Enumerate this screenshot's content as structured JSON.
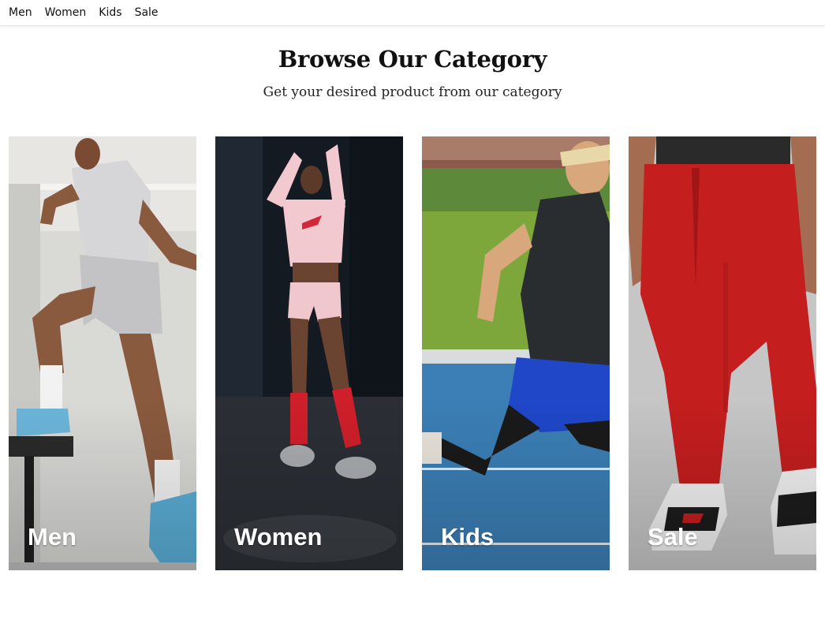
{
  "nav": {
    "items": [
      "Men",
      "Women",
      "Kids",
      "Sale"
    ]
  },
  "hero": {
    "title": "Browse Our Category",
    "subtitle": "Get your desired product from our category"
  },
  "categories": [
    {
      "label": "Men",
      "image": "man-stepping-on-bench-photo"
    },
    {
      "label": "Women",
      "image": "woman-in-pink-top-red-socks-photo"
    },
    {
      "label": "Kids",
      "image": "boy-running-on-track-photo"
    },
    {
      "label": "Sale",
      "image": "red-jogger-pants-sneakers-photo"
    }
  ],
  "colors": {
    "text": "#111111",
    "card_label": "#ffffff",
    "pants_red": "#c41e1e",
    "track_blue": "#3b7fb6",
    "shorts_blue": "#1f47c8",
    "pink_top": "#f2c9cf"
  }
}
